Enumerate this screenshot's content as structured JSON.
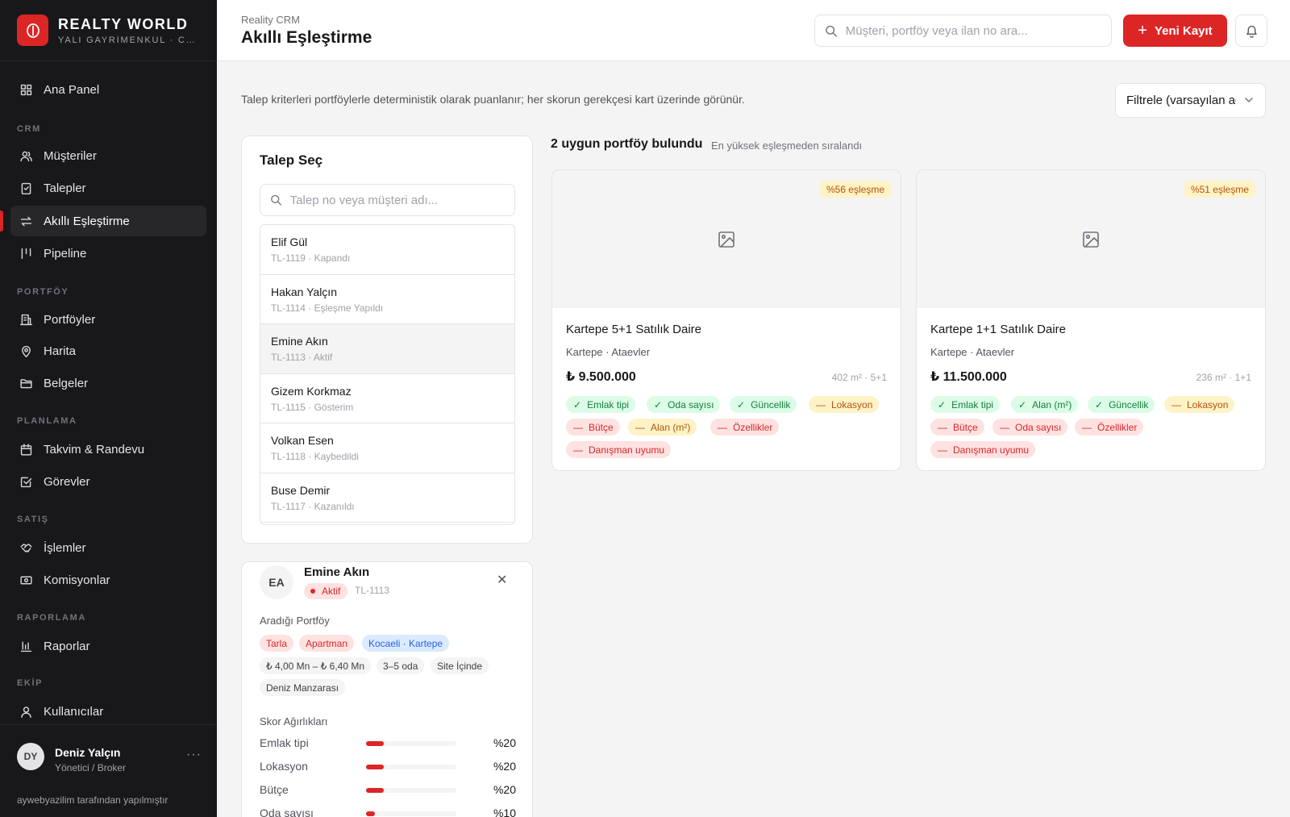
{
  "brand": {
    "name": "REALTY WORLD",
    "subtitle": "YALI GAYRİMENKUL · CR..."
  },
  "sidebar": {
    "items": [
      {
        "label": "Ana Panel",
        "icon": "grid-icon"
      },
      {
        "section": "CRM"
      },
      {
        "label": "Müşteriler",
        "icon": "users-icon"
      },
      {
        "label": "Talepler",
        "icon": "clipboard-icon"
      },
      {
        "label": "Akıllı Eşleştirme",
        "icon": "arrows-icon",
        "active": true
      },
      {
        "label": "Pipeline",
        "icon": "pipeline-icon"
      },
      {
        "section": "PORTFÖY"
      },
      {
        "label": "Portföyler",
        "icon": "building-icon"
      },
      {
        "label": "Harita",
        "icon": "map-pin-icon"
      },
      {
        "label": "Belgeler",
        "icon": "folder-icon"
      },
      {
        "section": "PLANLAMA"
      },
      {
        "label": "Takvim & Randevu",
        "icon": "calendar-icon"
      },
      {
        "label": "Görevler",
        "icon": "check-square-icon"
      },
      {
        "section": "SATIŞ"
      },
      {
        "label": "İşlemler",
        "icon": "handshake-icon"
      },
      {
        "label": "Komisyonlar",
        "icon": "banknote-icon"
      },
      {
        "section": "RAPORLAMA"
      },
      {
        "label": "Raporlar",
        "icon": "bar-chart-icon"
      },
      {
        "section": "EKİP"
      },
      {
        "label": "Kullanıcılar",
        "icon": "user-icon"
      }
    ],
    "user": {
      "initials": "DY",
      "name": "Deniz Yalçın",
      "role": "Yönetici / Broker"
    },
    "credit": "aywebyazilim tarafından yapılmıştır"
  },
  "header": {
    "breadcrumb": "Reality CRM",
    "title": "Akıllı Eşleştirme",
    "search_placeholder": "Müşteri, portföy veya ilan no ara...",
    "new_button": "Yeni Kayıt"
  },
  "main": {
    "description": "Talep kriterleri portföylerle deterministik olarak puanlanır; her skorun gerekçesi kart üzerinde görünür.",
    "filter_label": "Filtrele (varsayılan ağırlık)"
  },
  "talep_panel": {
    "title": "Talep Seç",
    "search_placeholder": "Talep no veya müşteri adı...",
    "items": [
      {
        "name": "Elif Gül",
        "meta": "TL-1119 · Kapandı"
      },
      {
        "name": "Hakan Yalçın",
        "meta": "TL-1114 · Eşleşme Yapıldı"
      },
      {
        "name": "Emine Akın",
        "meta": "TL-1113 · Aktif",
        "selected": true
      },
      {
        "name": "Gizem Korkmaz",
        "meta": "TL-1115 · Gösterim"
      },
      {
        "name": "Volkan Esen",
        "meta": "TL-1118 · Kaybedildi"
      },
      {
        "name": "Buse Demir",
        "meta": "TL-1117 · Kazanıldı"
      }
    ]
  },
  "detail": {
    "initials": "EA",
    "name": "Emine Akın",
    "status": "Aktif",
    "code": "TL-1113",
    "wanted_label": "Aradığı Portföy",
    "chips": [
      {
        "text": "Tarla",
        "color": "red"
      },
      {
        "text": "Apartman",
        "color": "red"
      },
      {
        "text": "Kocaeli · Kartepe",
        "color": "blue"
      },
      {
        "text": "₺ 4,00 Mn – ₺ 6,40 Mn",
        "color": "gray"
      },
      {
        "text": "3–5 oda",
        "color": "gray"
      },
      {
        "text": "Site İçinde",
        "color": "gray"
      },
      {
        "text": "Deniz Manzarası",
        "color": "gray"
      }
    ],
    "weights_label": "Skor Ağırlıkları",
    "weights": [
      {
        "label": "Emlak tipi",
        "value": "%20",
        "fraction": 0.2
      },
      {
        "label": "Lokasyon",
        "value": "%20",
        "fraction": 0.2
      },
      {
        "label": "Bütçe",
        "value": "%20",
        "fraction": 0.2
      },
      {
        "label": "Oda sayısı",
        "value": "%10",
        "fraction": 0.1
      }
    ]
  },
  "results": {
    "title": "2 uygun portföy bulundu",
    "subtitle": "En yüksek eşleşmeden sıralandı",
    "cards": [
      {
        "badge": "%56 eşleşme",
        "title": "Kartepe 5+1 Satılık Daire",
        "location": "Kartepe · Ataevler",
        "price": "₺ 9.500.000",
        "spec": "402 m² · 5+1",
        "tags": [
          {
            "text": "Emlak tipi",
            "state": "ok"
          },
          {
            "text": "Oda sayısı",
            "state": "ok"
          },
          {
            "text": "Güncellik",
            "state": "ok"
          },
          {
            "text": "Lokasyon",
            "state": "mid"
          },
          {
            "text": "Bütçe",
            "state": "no"
          },
          {
            "text": "Alan (m²)",
            "state": "mid"
          },
          {
            "text": "Özellikler",
            "state": "no"
          },
          {
            "text": "Danışman uyumu",
            "state": "no"
          }
        ]
      },
      {
        "badge": "%51 eşleşme",
        "title": "Kartepe 1+1 Satılık Daire",
        "location": "Kartepe · Ataevler",
        "price": "₺ 11.500.000",
        "spec": "236 m² · 1+1",
        "tags": [
          {
            "text": "Emlak tipi",
            "state": "ok"
          },
          {
            "text": "Alan (m²)",
            "state": "ok"
          },
          {
            "text": "Güncellik",
            "state": "ok"
          },
          {
            "text": "Lokasyon",
            "state": "mid"
          },
          {
            "text": "Bütçe",
            "state": "no"
          },
          {
            "text": "Oda sayısı",
            "state": "no"
          },
          {
            "text": "Özellikler",
            "state": "no"
          },
          {
            "text": "Danışman uyumu",
            "state": "no"
          }
        ]
      }
    ]
  }
}
